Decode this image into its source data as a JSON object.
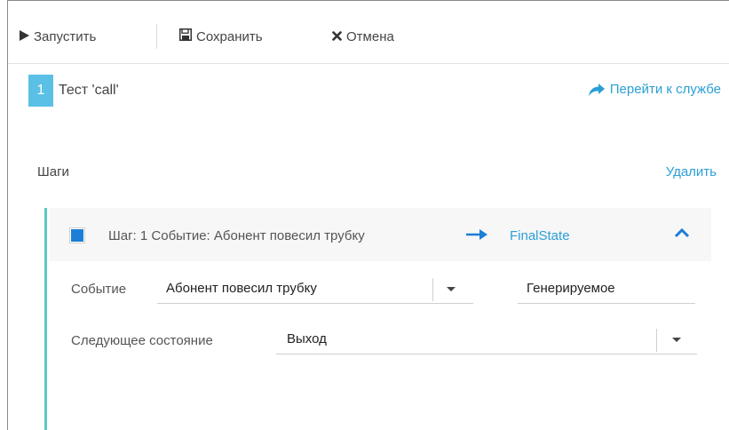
{
  "toolbar": {
    "run_label": "Запустить",
    "save_label": "Сохранить",
    "cancel_label": "Отмена"
  },
  "test": {
    "number": "1",
    "title": "Тест 'call'",
    "goto_label": "Перейти к службе"
  },
  "steps": {
    "title": "Шаги",
    "delete_label": "Удалить"
  },
  "step": {
    "header_text": "Шаг: 1 Событие: Абонент повесил трубку",
    "target_state": "FinalState",
    "event_label": "Событие",
    "event_value": "Абонент повесил трубку",
    "event_type": "Генерируемое",
    "next_state_label": "Следующее состояние",
    "next_state_value": "Выход"
  },
  "colors": {
    "accent": "#2a9fd6",
    "badge": "#5bc0e6",
    "step_border": "#5bc9c4",
    "checkbox": "#1c7ed6"
  },
  "icons": [
    "play-icon",
    "floppy-icon",
    "close-icon",
    "share-arrow-icon",
    "arrow-right-icon",
    "chevron-up-icon",
    "caret-down-icon"
  ]
}
